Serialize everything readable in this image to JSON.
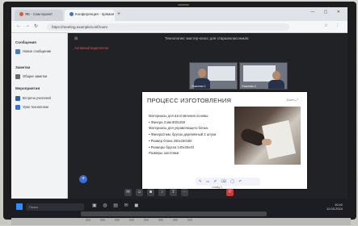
{
  "browser": {
    "tabs": [
      {
        "label": "ЯК - Сам проект"
      },
      {
        "label": "Конференция - прямая"
      }
    ],
    "url": "https://meeting.example/conf/room",
    "new_tab_symbol": "+",
    "window_controls": "— ▢ ✕"
  },
  "sidebar": {
    "section_1": "Сообщения",
    "section_2": "Заметки",
    "section_3": "Мероприятия",
    "items": [
      {
        "label": "Новое сообщение",
        "color": "#4a78c2"
      },
      {
        "label": "Общие заметки",
        "color": "#6a6a6a"
      },
      {
        "label": "Встреча учителей",
        "color": "#2e5fa8"
      },
      {
        "label": "Урок технологии",
        "color": "#3b6fd8"
      }
    ]
  },
  "meeting": {
    "title": "Технологии: мастер-класс для старшеклассников",
    "subtitle": "Активный видеопоток",
    "videos": [
      {
        "caption": "Участник 1"
      },
      {
        "caption": "Участник 2"
      }
    ],
    "fab_symbol": "+"
  },
  "slide": {
    "title": "ПРОЦЕСС ИЗГОТОВЛЕНИЯ",
    "tools": "Zoom ⤢ ⋯",
    "lines": [
      "Материалы для изготовления основы:",
      "• Фанера 3 мм 800х250",
      "Материалы для управляющего блока:",
      "• Фанера3 мм, брусок деревянный 2 штуки",
      "• Размер блока 250х150х50",
      "• Размеры бруска 140х30х40",
      "Размеры заготовки"
    ],
    "toolbar": "✎ ▭ ✐ ⌫ ◯ ↶",
    "pager": "слайд 3"
  },
  "taskbar": {
    "search_placeholder": "Поиск",
    "apps": "▣ ◍ ▤ ✉ ◼",
    "time": "10:42",
    "date": "12.03.2024"
  }
}
